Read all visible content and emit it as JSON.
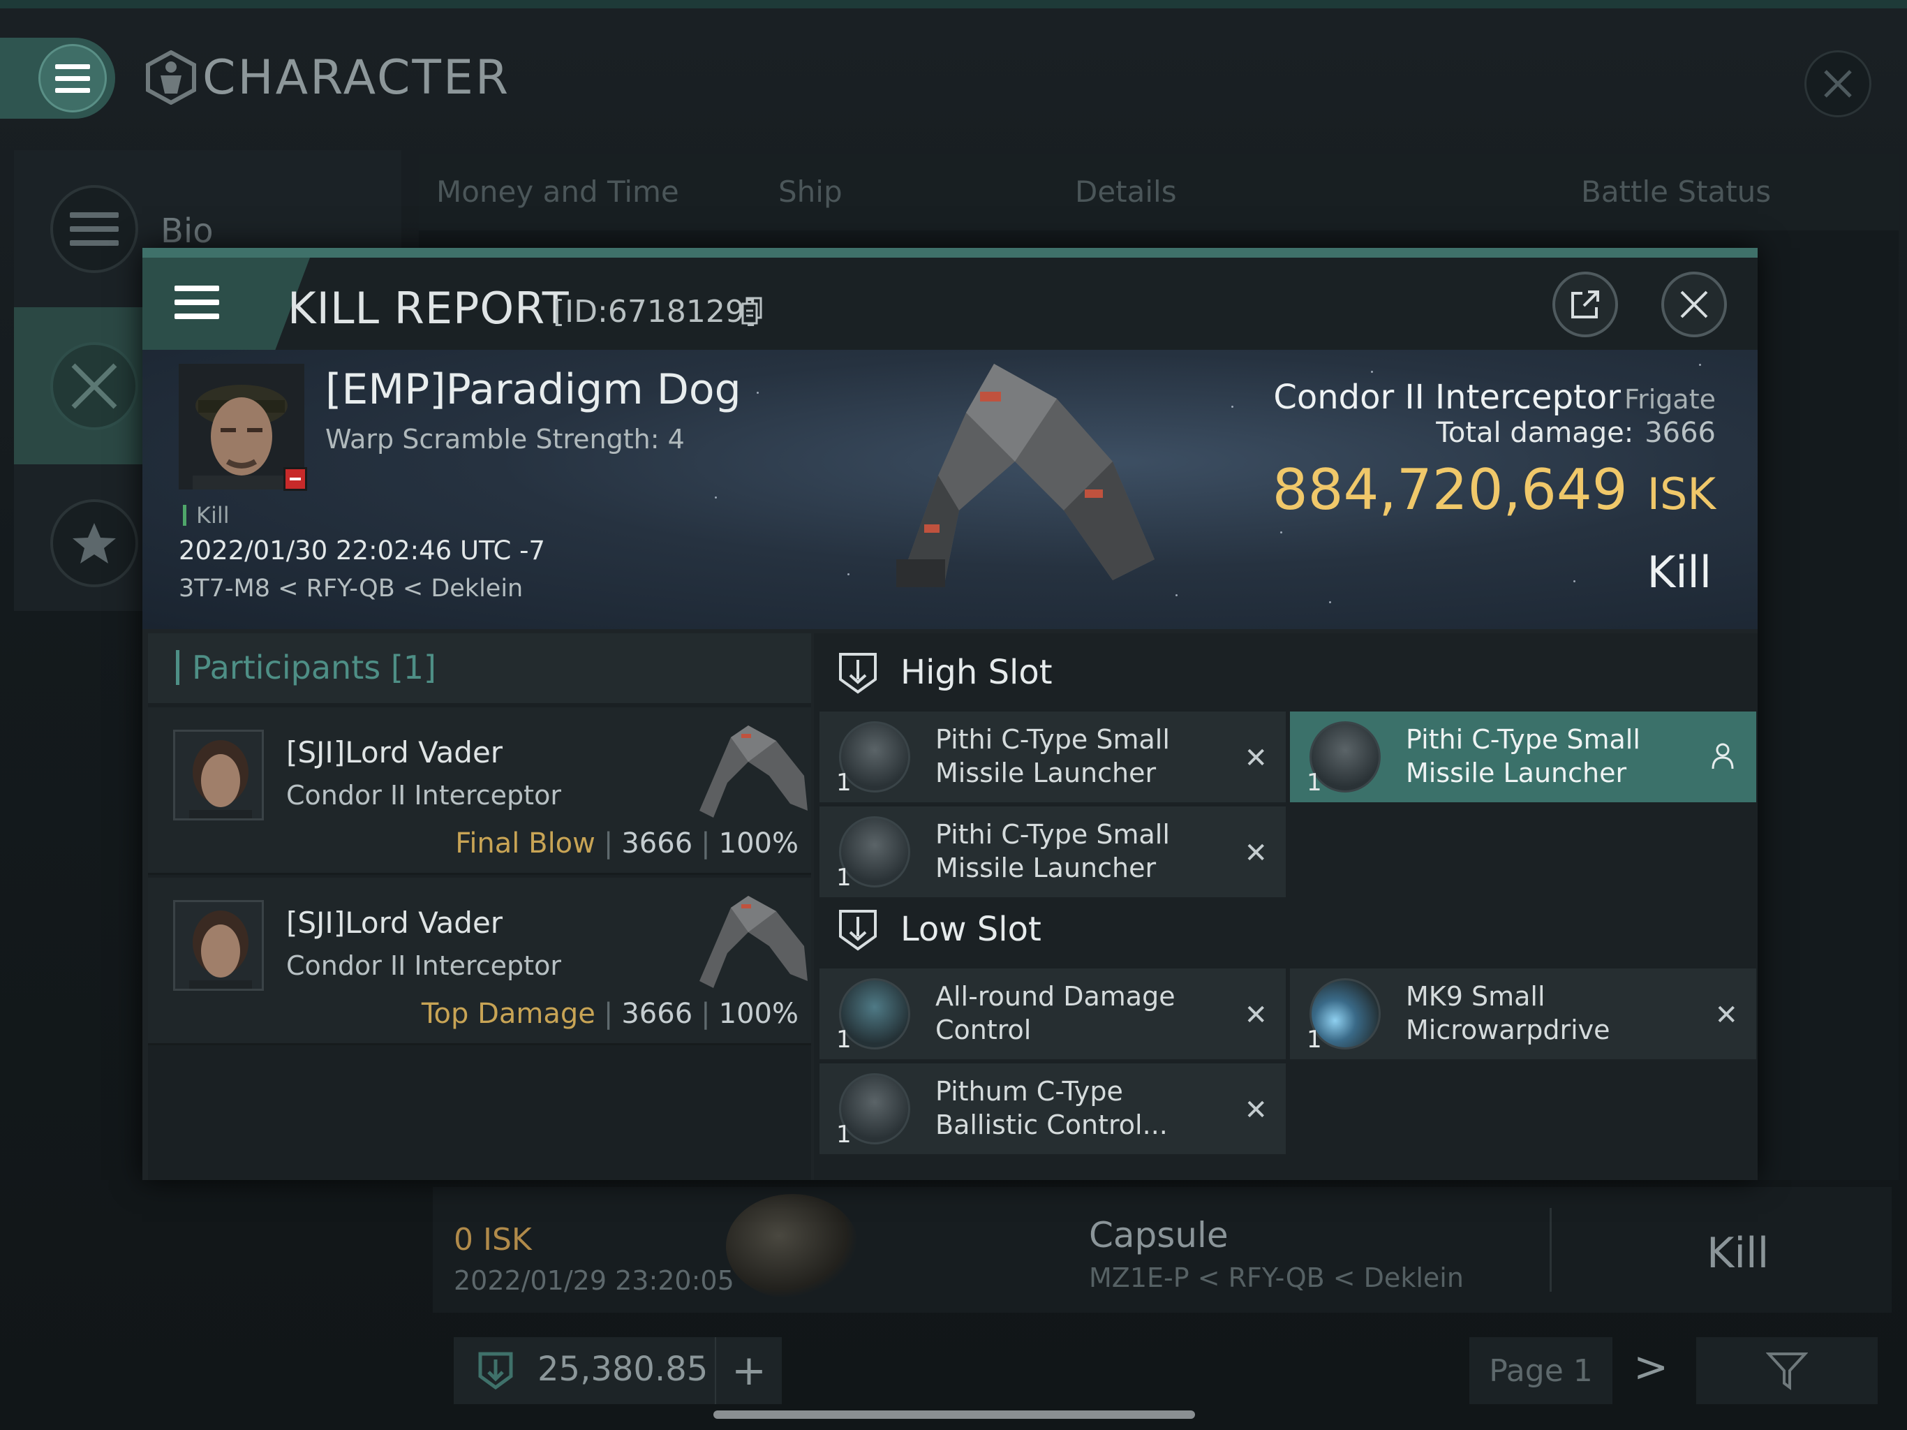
{
  "background": {
    "title": "CHARACTER",
    "sidebar": [
      {
        "label": "Bio"
      }
    ],
    "tabs": [
      "Money and Time",
      "Ship",
      "Details",
      "Battle Status"
    ],
    "row": {
      "isk": "0  ISK",
      "date": "2022/01/29  23:20:05",
      "ship": "Capsule",
      "location": "MZ1E-P < RFY-QB < Deklein",
      "result": "Kill"
    },
    "wallet": "25,380.85",
    "page": "Page 1"
  },
  "modal": {
    "title": "KILL REPORT",
    "id": "[ID:6718129]",
    "victim": {
      "name": "[EMP]Paradigm Dog",
      "sub": "Warp Scramble Strength: 4",
      "tag": "Kill",
      "date": "2022/01/30 22:02:46 UTC -7",
      "location": "3T7-M8 < RFY-QB < Deklein"
    },
    "ship": {
      "name": "Condor II Interceptor",
      "class": "Frigate",
      "total_damage_label": "Total damage:",
      "total_damage": "3666",
      "isk_value": "884,720,649",
      "isk_unit": "ISK",
      "result": "Kill"
    },
    "participants": {
      "title": "Participants [1]",
      "rows": [
        {
          "name": "[SJI]Lord Vader",
          "ship": "Condor II Interceptor",
          "role": "Final Blow",
          "damage": "3666",
          "percent": "100%"
        },
        {
          "name": "[SJI]Lord Vader",
          "ship": "Condor II Interceptor",
          "role": "Top Damage",
          "damage": "3666",
          "percent": "100%"
        }
      ]
    },
    "fitting": {
      "high_slot": {
        "title": "High Slot",
        "modules": [
          {
            "name": "Pithi C-Type Small\nMissile Launcher",
            "qty": "1"
          },
          {
            "name": "Pithi C-Type Small\nMissile Launcher",
            "qty": "1"
          },
          {
            "name": "Pithi C-Type Small\nMissile Launcher",
            "qty": "1"
          }
        ]
      },
      "low_slot": {
        "title": "Low Slot",
        "modules": [
          {
            "name": "All-round Damage\nControl",
            "qty": "1"
          },
          {
            "name": "MK9 Small\nMicrowarpdrive",
            "qty": "1"
          },
          {
            "name": "Pithum C-Type\nBallistic Control...",
            "qty": "1"
          }
        ]
      }
    }
  },
  "colors": {
    "accent": "#3f716a",
    "isk_gold": "#f0c86a",
    "role_gold": "#c8a455",
    "participants_teal": "#4e8f86"
  }
}
